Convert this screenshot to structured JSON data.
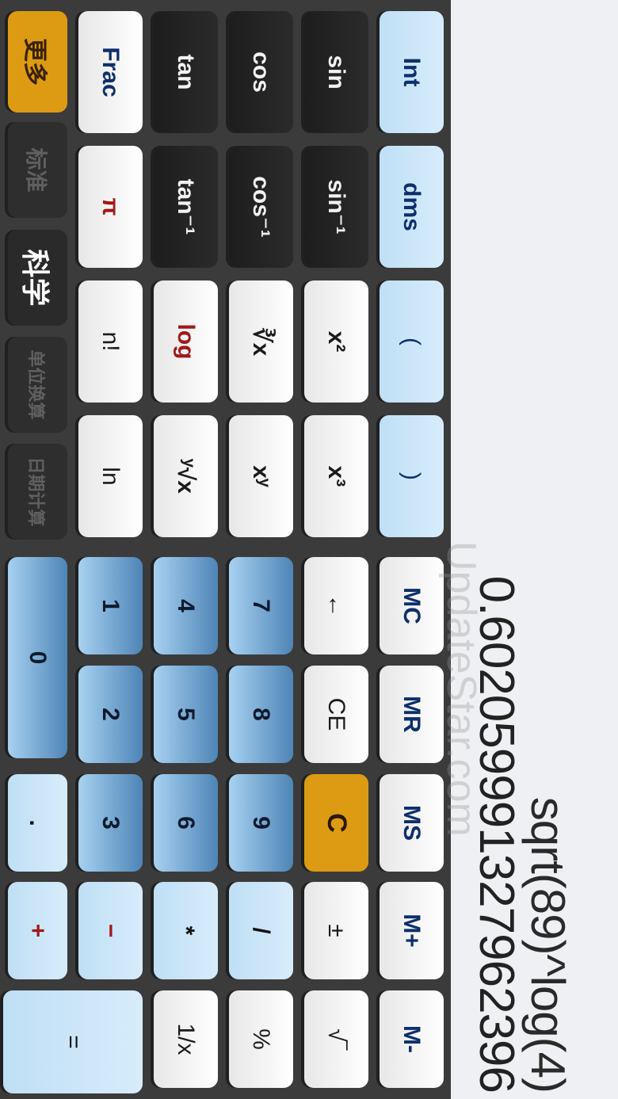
{
  "display": {
    "expression": "sqrt(89)^log(4)",
    "result": "0.602059991327962396"
  },
  "watermark": "UpdateStar.com",
  "memory": {
    "mc": "MC",
    "mr": "MR",
    "ms": "MS",
    "mplus": "M+",
    "mminus": "M-"
  },
  "sci": {
    "int": "Int",
    "dms": "dms",
    "lparen": "(",
    "rparen": ")",
    "sin": "sin",
    "asin": "sin⁻¹",
    "square": "x²",
    "cube": "x³",
    "cos": "cos",
    "acos": "cos⁻¹",
    "cbrt": "∛x",
    "pow": "xʸ",
    "tan": "tan",
    "atan": "tan⁻¹",
    "log": "log",
    "yroot": "ʸ√x",
    "frac": "Frac",
    "pi": "π",
    "fact": "n!",
    "ln": "ln"
  },
  "edit": {
    "back": "←",
    "ce": "CE",
    "c": "C",
    "sign": "±",
    "sqrt": "√‾"
  },
  "digits": {
    "d0": "0",
    "d1": "1",
    "d2": "2",
    "d3": "3",
    "d4": "4",
    "d5": "5",
    "d6": "6",
    "d7": "7",
    "d8": "8",
    "d9": "9",
    "dot": "."
  },
  "ops": {
    "div": "/",
    "mul": "*",
    "sub": "−",
    "add": "+",
    "percent": "%",
    "recip": "1/x",
    "equals": "="
  },
  "tabs": {
    "more": "更多",
    "standard": "标准",
    "science": "科学",
    "units": "单位换算",
    "dates": "日期计算"
  },
  "colors": {
    "accent_orange": "#dc9b12",
    "key_light_blue": "#cde6f8",
    "key_dark": "#252525",
    "display_bg": "#eef0f3"
  }
}
